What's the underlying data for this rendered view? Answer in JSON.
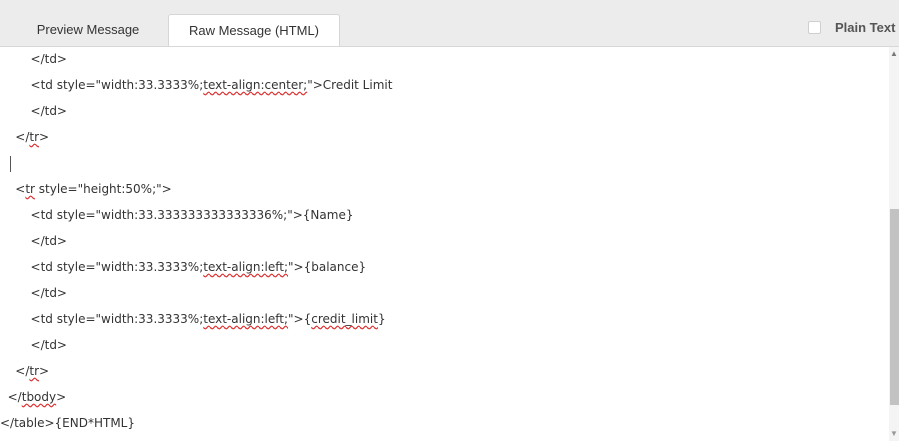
{
  "tabs": {
    "preview": "Preview Message",
    "raw": "Raw Message (HTML)"
  },
  "plain_text_label": "Plain Text",
  "plain_text_checked": false,
  "editor": {
    "lines": [
      [
        "        </td>"
      ],
      [
        "        <td style=\"width:33.3333%;",
        {
          "t": "text-align:center;",
          "s": true
        },
        "\">Credit Limit"
      ],
      [
        "        </td>"
      ],
      [
        "    </",
        {
          "t": "tr",
          "s": true
        },
        ">"
      ],
      [
        ""
      ],
      [
        "    <",
        {
          "t": "tr",
          "s": true
        },
        " style=\"height:50%;\">"
      ],
      [
        "        <td style=\"width:33.333333333333336%;\">{Name}"
      ],
      [
        "        </td>"
      ],
      [
        "        <td style=\"width:33.3333%;",
        {
          "t": "text-align:left;",
          "s": true
        },
        "\">{balance}"
      ],
      [
        "        </td>"
      ],
      [
        "        <td style=\"width:33.3333%;",
        {
          "t": "text-align:left;",
          "s": true
        },
        "\">{",
        {
          "t": "credit_limit",
          "s": true
        },
        "}"
      ],
      [
        "        </td>"
      ],
      [
        "    </",
        {
          "t": "tr",
          "s": true
        },
        ">"
      ],
      [
        "  </",
        {
          "t": "tbody",
          "s": true
        },
        ">"
      ],
      [
        "</table>{END*HTML}"
      ]
    ]
  },
  "icons": {
    "scroll_up": "triangle-up-icon",
    "scroll_down": "triangle-down-icon"
  }
}
